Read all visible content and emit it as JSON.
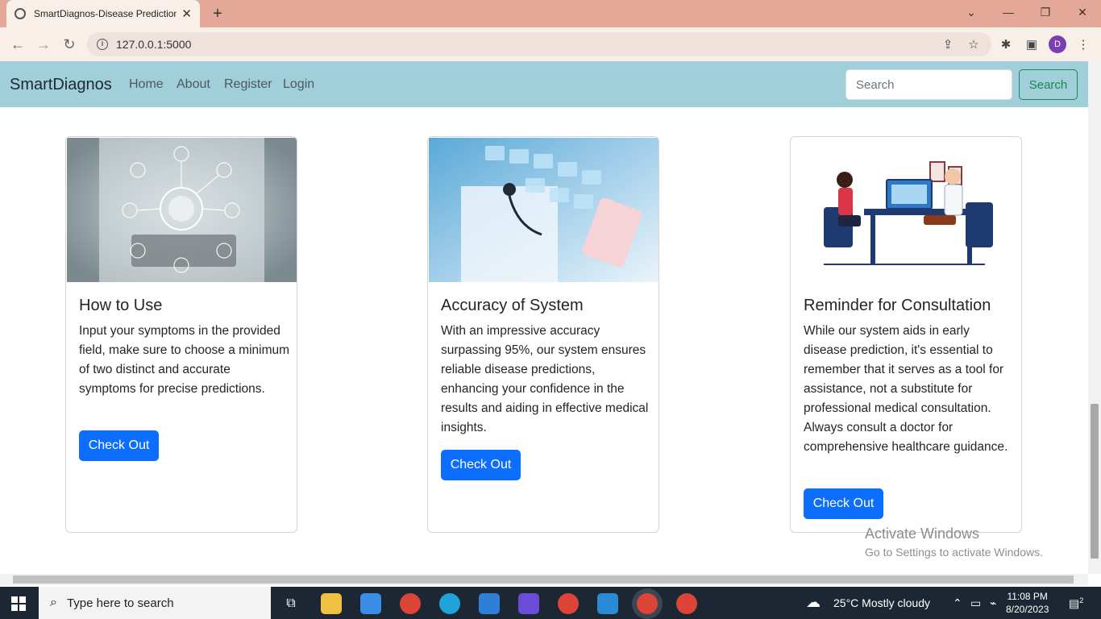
{
  "browser": {
    "tab_title": "SmartDiagnos-Disease Prediction",
    "tab_close": "✕",
    "new_tab": "+",
    "url": "127.0.0.1:5000",
    "profile_initial": "D"
  },
  "navbar": {
    "brand": "SmartDiagnos",
    "links": [
      "Home",
      "About",
      "Register",
      "Login"
    ],
    "search_placeholder": "Search",
    "search_button": "Search"
  },
  "cards": [
    {
      "title": "How to Use",
      "text": "Input your symptoms in the provided field, make sure to choose a minimum of two distinct and accurate symptoms for precise predictions.",
      "button": "Check Out"
    },
    {
      "title": "Accuracy of System",
      "text": "With an impressive accuracy surpassing 95%, our system ensures reliable disease predictions, enhancing your confidence in the results and aiding in effective medical insights.",
      "button": "Check Out"
    },
    {
      "title": "Reminder for Consultation",
      "text": "While our system aids in early disease prediction, it's essential to remember that it serves as a tool for assistance, not a substitute for professional medical consultation. Always consult a doctor for comprehensive healthcare guidance.",
      "button": "Check Out"
    }
  ],
  "watermark": {
    "line1": "Activate Windows",
    "line2": "Go to Settings to activate Windows."
  },
  "taskbar": {
    "search_placeholder": "Type here to search",
    "weather": "25°C  Mostly cloudy",
    "time": "11:08 PM",
    "date": "8/20/2023",
    "notification_count": "2"
  },
  "colors": {
    "tabbar": "#e3a898",
    "navbar": "#a0cfd9",
    "primary_button": "#0d6efd",
    "search_button": "#198754",
    "taskbar": "#1d2733"
  }
}
